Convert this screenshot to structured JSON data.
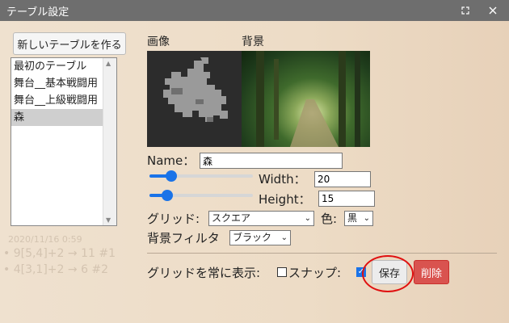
{
  "window": {
    "title": "テーブル設定",
    "maximize_icon": "maximize-icon",
    "close_icon": "close-icon"
  },
  "sidebar": {
    "new_table_label": "新しいテーブルを作る",
    "items": [
      {
        "label": "最初のテーブル",
        "selected": false
      },
      {
        "label": "舞台__基本戦闘用",
        "selected": false
      },
      {
        "label": "舞台__上級戦闘用",
        "selected": false
      },
      {
        "label": "森",
        "selected": true
      }
    ]
  },
  "main": {
    "image_label": "画像",
    "background_label": "背景",
    "name_label": "Name：",
    "name_value": "森",
    "width_label": "Width：",
    "width_value": "20",
    "height_label": "Height：",
    "height_value": "15",
    "grid_label": "グリッド:",
    "grid_value": "スクエア",
    "color_label": "色:",
    "color_value": "黒",
    "bg_filter_label": "背景フィルタ",
    "bg_filter_value": "ブラック",
    "always_show_grid_label": "グリッドを常に表示:",
    "always_show_grid_checked": false,
    "snap_label": "スナップ:",
    "snap_checked": true,
    "save_label": "保存",
    "delete_label": "削除"
  },
  "background_log": {
    "date": "2020/11/16 0:59",
    "line1": "• 9[5,4]+2 → 11 #1",
    "line2": "• 4[3,1]+2 → 6 #2"
  },
  "colors": {
    "accent": "#1a73e8",
    "delete": "#d9534f",
    "highlight_circle": "#e01010",
    "titlebar": "#6e6e6e"
  }
}
